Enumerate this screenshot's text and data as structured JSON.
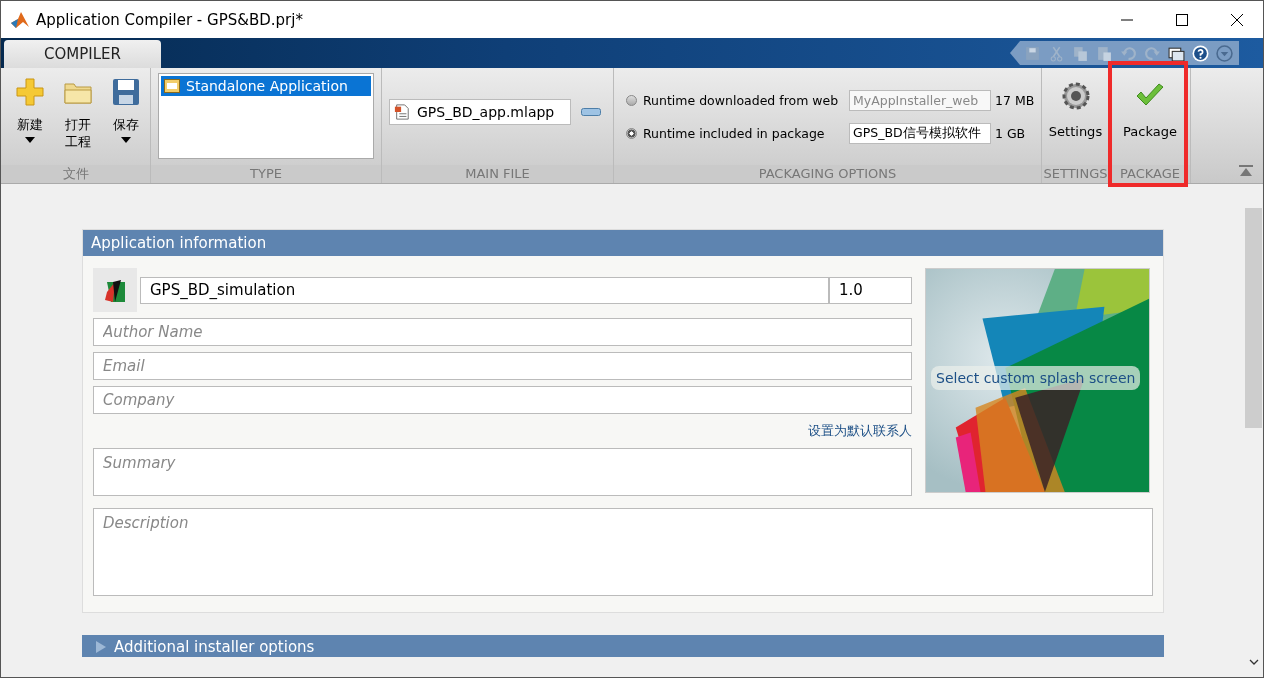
{
  "window": {
    "title": "Application Compiler - GPS&BD.prj*"
  },
  "tabs": [
    {
      "label": "COMPILER",
      "selected": true
    }
  ],
  "ribbon": {
    "file_group": {
      "label": "文件",
      "buttons": [
        {
          "kind": "new",
          "label": "新建",
          "dropdown": true
        },
        {
          "kind": "open",
          "label": "打开工程",
          "dropdown": false
        },
        {
          "kind": "save",
          "label": "保存",
          "dropdown": true
        }
      ]
    },
    "type_group": {
      "label": "TYPE",
      "items": [
        {
          "label": "Standalone Application",
          "selected": true
        }
      ]
    },
    "main_file_group": {
      "label": "MAIN FILE",
      "files": [
        "GPS_BD_app.mlapp"
      ]
    },
    "packaging_group": {
      "label": "PACKAGING OPTIONS",
      "options": [
        {
          "label": "Runtime downloaded from web",
          "selected": false,
          "value": "MyAppInstaller_web",
          "disabled": true,
          "size": "17 MB"
        },
        {
          "label": "Runtime included in package",
          "selected": true,
          "value": "GPS_BD信号模拟软件",
          "disabled": false,
          "size": "1 GB"
        }
      ]
    },
    "settings_group": {
      "label": "SETTINGS",
      "button": "Settings"
    },
    "package_group": {
      "label": "PACKAGE",
      "button": "Package",
      "highlighted": true
    }
  },
  "app_info": {
    "title": "Application information",
    "name": "GPS_BD_simulation",
    "version": "1.0",
    "fields": [
      {
        "placeholder": "Author Name"
      },
      {
        "placeholder": "Email"
      },
      {
        "placeholder": "Company"
      }
    ],
    "default_contact_link": "设置为默认联系人",
    "summary_placeholder": "Summary",
    "description_placeholder": "Description",
    "splash_label": "Select custom splash screen"
  },
  "next_section": {
    "title": "Additional installer options",
    "expanded": false
  }
}
